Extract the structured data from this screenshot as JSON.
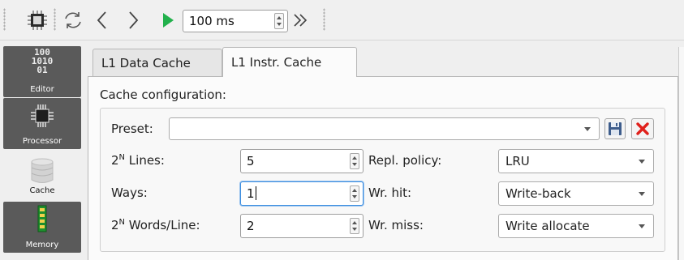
{
  "toolbar": {
    "icons": [
      "chip-icon",
      "refresh-icon",
      "back-icon",
      "forward-icon",
      "run-icon",
      "fast-forward-icon"
    ],
    "delay": "100 ms",
    "accent_color": "#22b14c"
  },
  "sidebar": {
    "items": [
      {
        "label": "Editor",
        "icon": "editor-binary-icon",
        "glyph": "100\n1010\n01"
      },
      {
        "label": "Processor",
        "icon": "processor-chip-icon"
      },
      {
        "label": "Cache",
        "icon": "cache-database-icon"
      },
      {
        "label": "Memory",
        "icon": "memory-stick-icon"
      }
    ]
  },
  "tabs": [
    {
      "label": "L1 Data Cache",
      "active": false
    },
    {
      "label": "L1 Instr. Cache",
      "active": true
    }
  ],
  "cache_config": {
    "section_title": "Cache configuration:",
    "preset_label": "Preset:",
    "preset_value": "",
    "save_icon": "save-icon",
    "delete_icon": "delete-icon",
    "lines_label_base": "2",
    "lines_label_sup": "N",
    "lines_label_rest": " Lines:",
    "lines_value": "5",
    "ways_label": "Ways:",
    "ways_value": "1",
    "words_label_base": "2",
    "words_label_sup": "N",
    "words_label_rest": " Words/Line:",
    "words_value": "2",
    "repl_label": "Repl. policy:",
    "repl_value": "LRU",
    "wr_hit_label": "Wr. hit:",
    "wr_hit_value": "Write-back",
    "wr_miss_label": "Wr. miss:",
    "wr_miss_value": "Write allocate"
  }
}
